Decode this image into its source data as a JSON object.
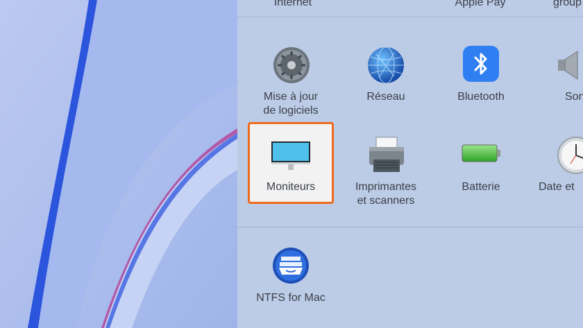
{
  "top_row": {
    "internet": "Internet",
    "apple_pay": "Apple Pay",
    "groups": "group"
  },
  "row2": [
    {
      "label_line1": "Mise à jour",
      "label_line2": "de logiciels"
    },
    {
      "label_line1": "Réseau"
    },
    {
      "label_line1": "Bluetooth"
    },
    {
      "label_line1": "Son"
    }
  ],
  "row3": [
    {
      "label_line1": "Moniteurs",
      "selected": true,
      "highlight_color": "#f06a1c"
    },
    {
      "label_line1": "Imprimantes",
      "label_line2": "et scanners"
    },
    {
      "label_line1": "Batterie"
    },
    {
      "label_line1": "Date et"
    }
  ],
  "other": [
    {
      "label_line1": "NTFS for Mac"
    }
  ],
  "colors": {
    "panel_bg": "#bccbe6",
    "accent": "#f06a1c",
    "wallpaper": "#a9bcec"
  }
}
